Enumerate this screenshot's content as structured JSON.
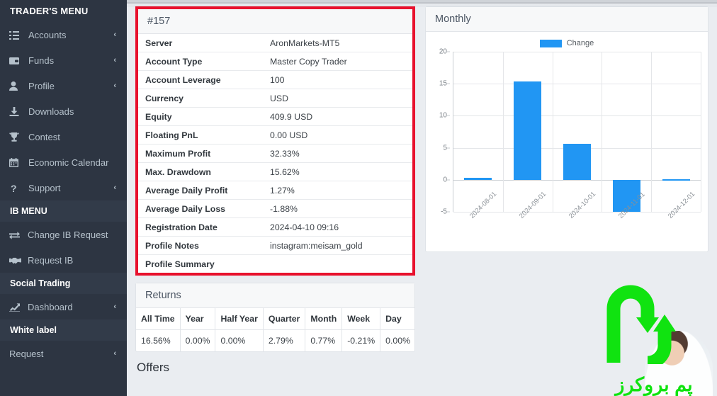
{
  "sidebar": {
    "title": "TRADER'S MENU",
    "trader_items": [
      {
        "label": "Accounts",
        "icon": "list-icon",
        "chevron": "‹"
      },
      {
        "label": "Funds",
        "icon": "wallet-icon",
        "chevron": "‹"
      },
      {
        "label": "Profile",
        "icon": "user-icon",
        "chevron": "‹"
      },
      {
        "label": "Downloads",
        "icon": "download-icon",
        "chevron": ""
      },
      {
        "label": "Contest",
        "icon": "trophy-icon",
        "chevron": ""
      },
      {
        "label": "Economic Calendar",
        "icon": "calendar-icon",
        "chevron": ""
      },
      {
        "label": "Support",
        "icon": "question-icon",
        "chevron": "‹"
      }
    ],
    "ib_heading": "IB MENU",
    "ib_items": [
      {
        "label": "Change IB Request",
        "icon": "exchange-icon",
        "chevron": ""
      },
      {
        "label": "Request IB",
        "icon": "handshake-icon",
        "chevron": ""
      }
    ],
    "social_heading": "Social Trading",
    "social_items": [
      {
        "label": "Dashboard",
        "icon": "chart-line-icon",
        "chevron": "‹"
      }
    ],
    "whitelabel_heading": "White label",
    "whitelabel_items": [
      {
        "label": "Request",
        "icon": "",
        "chevron": "‹"
      }
    ]
  },
  "account_card": {
    "title": "#157",
    "border_color": "#e8112d",
    "rows": [
      {
        "key": "Server",
        "value": "AronMarkets-MT5"
      },
      {
        "key": "Account Type",
        "value": "Master Copy Trader"
      },
      {
        "key": "Account Leverage",
        "value": "100"
      },
      {
        "key": "Currency",
        "value": "USD"
      },
      {
        "key": "Equity",
        "value": "409.9 USD"
      },
      {
        "key": "Floating PnL",
        "value": "0.00 USD"
      },
      {
        "key": "Maximum Profit",
        "value": "32.33%"
      },
      {
        "key": "Max. Drawdown",
        "value": "15.62%"
      },
      {
        "key": "Average Daily Profit",
        "value": "1.27%"
      },
      {
        "key": "Average Daily Loss",
        "value": "-1.88%"
      },
      {
        "key": "Registration Date",
        "value": "2024-04-10 09:16"
      },
      {
        "key": "Profile Notes",
        "value": "instagram:meisam_gold"
      },
      {
        "key": "Profile Summary",
        "value": ""
      }
    ]
  },
  "returns_card": {
    "title": "Returns",
    "headers": [
      "All Time",
      "Year",
      "Half Year",
      "Quarter",
      "Month",
      "Week",
      "Day"
    ],
    "values": [
      "16.56%",
      "0.00%",
      "0.00%",
      "2.79%",
      "0.77%",
      "-0.21%",
      "0.00%"
    ]
  },
  "offers": {
    "title": "Offers"
  },
  "chart_card": {
    "title": "Monthly"
  },
  "chart_data": {
    "type": "bar",
    "title": "Monthly",
    "categories": [
      "2024-08-01",
      "2024-09-01",
      "2024-10-01",
      "2024-11-01",
      "2024-12-01"
    ],
    "series": [
      {
        "name": "Change",
        "values": [
          0.3,
          15.4,
          5.6,
          -5.0,
          0.1
        ],
        "color": "#2196f3"
      }
    ],
    "ylabel": "",
    "xlabel": "",
    "ylim": [
      -5,
      20
    ],
    "yticks": [
      20,
      15,
      10,
      5,
      0,
      -5
    ],
    "grid": true,
    "legend": "top-center"
  },
  "watermark": {
    "text": "پم بروکرز",
    "color": "#10e310"
  }
}
